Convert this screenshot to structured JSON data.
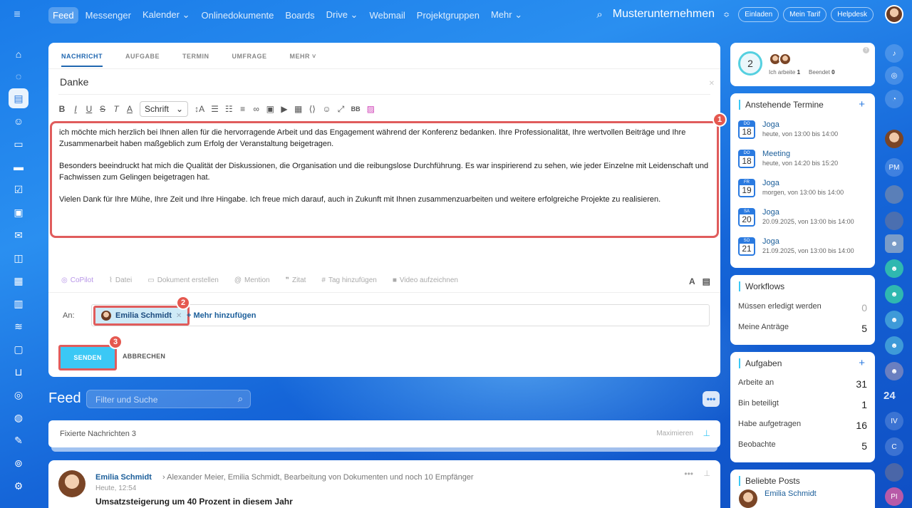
{
  "topbar": {
    "nav": [
      "Feed",
      "Messenger",
      "Kalender ⌄",
      "Onlinedokumente",
      "Boards",
      "Drive ⌄",
      "Webmail",
      "Projektgruppen",
      "Mehr ⌄"
    ],
    "company": "Musterunternehmen",
    "buttons": {
      "invite": "Einladen",
      "plan": "Mein Tarif",
      "help": "Helpdesk"
    }
  },
  "editor": {
    "tabs": [
      "NACHRICHT",
      "AUFGABE",
      "TERMIN",
      "UMFRAGE",
      "MEHR ˅"
    ],
    "subject": "Danke",
    "font_select": "Schrift",
    "body": [
      "ich möchte mich herzlich bei Ihnen allen für die hervorragende Arbeit und das Engagement während der Konferenz bedanken. Ihre Professionalität, Ihre wertvollen Beiträge und Ihre Zusammenarbeit haben maßgeblich zum Erfolg der Veranstaltung beigetragen.",
      "Besonders beeindruckt hat mich die Qualität der Diskussionen, die Organisation und die reibungslose Durchführung. Es war inspirierend zu sehen, wie jeder Einzelne mit Leidenschaft und Fachwissen zum Gelingen beigetragen hat.",
      "Vielen Dank für Ihre Mühe, Ihre Zeit und Ihre Hingabe. Ich freue mich darauf, auch in Zukunft mit Ihnen zusammenzuarbeiten und weitere erfolgreiche Projekte zu realisieren."
    ],
    "actions": {
      "copilot": "CoPilot",
      "file": "Datei",
      "doc": "Dokument erstellen",
      "mention": "Mention",
      "quote": "Zitat",
      "tag": "Tag hinzufügen",
      "video": "Video aufzeichnen"
    },
    "to_label": "An:",
    "recipient": "Emilia Schmidt",
    "add_more": "+ Mehr hinzufügen",
    "send": "SENDEN",
    "cancel": "ABBRECHEN",
    "badges": [
      "1",
      "2",
      "3"
    ]
  },
  "feed": {
    "title": "Feed",
    "search_placeholder": "Filter und Suche",
    "pinned_label": "Fixierte Nachrichten",
    "pinned_count": "3",
    "pinned_maximize": "Maximieren",
    "post": {
      "author": "Emilia Schmidt",
      "recipients": "Alexander Meier, Emilia Schmidt, Bearbeitung von Dokumenten  und noch 10 Empfänger",
      "time": "Heute, 12:54",
      "title": "Umsatzsteigerung um 40 Prozent in diesem Jahr"
    }
  },
  "right": {
    "status": {
      "count": "2",
      "working_label": "Ich arbeite",
      "working_count": "1",
      "finished_label": "Beendet",
      "finished_count": "0"
    },
    "events_title": "Anstehende Termine",
    "events": [
      {
        "day": "DO",
        "num": "18",
        "name": "Joga",
        "time": "heute, von 13:00 bis 14:00"
      },
      {
        "day": "DO",
        "num": "18",
        "name": "Meeting",
        "time": "heute, von 14:20 bis 15:20"
      },
      {
        "day": "FR",
        "num": "19",
        "name": "Joga",
        "time": "morgen, von 13:00 bis 14:00"
      },
      {
        "day": "SA",
        "num": "20",
        "name": "Joga",
        "time": "20.09.2025, von 13:00 bis 14:00"
      },
      {
        "day": "SO",
        "num": "21",
        "name": "Joga",
        "time": "21.09.2025, von 13:00 bis 14:00"
      }
    ],
    "workflows_title": "Workflows",
    "workflows": [
      {
        "label": "Müssen erledigt werden",
        "value": "0"
      },
      {
        "label": "Meine Anträge",
        "value": "5"
      }
    ],
    "tasks_title": "Aufgaben",
    "tasks": [
      {
        "label": "Arbeite an",
        "value": "31"
      },
      {
        "label": "Bin beteiligt",
        "value": "1"
      },
      {
        "label": "Habe aufgetragen",
        "value": "16"
      },
      {
        "label": "Beobachte",
        "value": "5"
      }
    ],
    "popular_title": "Beliebte Posts",
    "popular_author": "Emilia Schmidt",
    "rail_number": "24",
    "rail_initials": [
      "PM",
      "IV",
      "C",
      "PI"
    ]
  },
  "colors": {
    "accent": "#2a7ae0",
    "send": "#3bc8f5",
    "highlight": "#e05c5c"
  }
}
